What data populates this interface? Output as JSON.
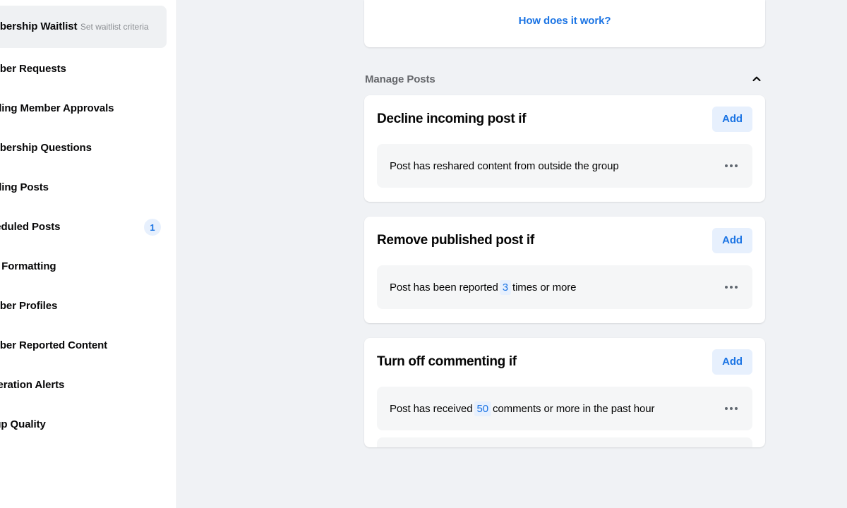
{
  "sidebar": {
    "items": [
      {
        "label": "Membership Waitlist",
        "sublabel": "Set waitlist criteria",
        "badge": "",
        "icon": "list-icon",
        "active": true
      },
      {
        "label": "Member Requests",
        "sublabel": "",
        "badge": "",
        "icon": "person-add-icon",
        "active": false
      },
      {
        "label": "Pending Member Approvals",
        "sublabel": "",
        "badge": "",
        "icon": "clock-icon",
        "active": false
      },
      {
        "label": "Membership Questions",
        "sublabel": "",
        "badge": "",
        "icon": "question-icon",
        "active": false
      },
      {
        "label": "Pending Posts",
        "sublabel": "",
        "badge": "",
        "icon": "posts-icon",
        "active": false
      },
      {
        "label": "Scheduled Posts",
        "sublabel": "",
        "badge": "1",
        "icon": "calendar-icon",
        "active": false
      },
      {
        "label": "Post Formatting",
        "sublabel": "",
        "badge": "",
        "icon": "format-icon",
        "active": false
      },
      {
        "label": "Member Profiles",
        "sublabel": "",
        "badge": "",
        "icon": "profile-icon",
        "active": false
      },
      {
        "label": "Member Reported Content",
        "sublabel": "",
        "badge": "",
        "icon": "flag-icon",
        "active": false
      },
      {
        "label": "Moderation Alerts",
        "sublabel": "",
        "badge": "",
        "icon": "bell-icon",
        "active": false
      },
      {
        "label": "Group Quality",
        "sublabel": "",
        "badge": "",
        "icon": "shield-icon",
        "active": false
      }
    ]
  },
  "main": {
    "top_card": {
      "link_label": "How does it work?"
    },
    "section": {
      "title": "Manage Posts",
      "collapse_icon": "chevron-up-icon",
      "expanded": true
    },
    "rules": [
      {
        "title": "Decline incoming post if",
        "add_label": "Add",
        "conditions": [
          {
            "prefix": "Post has reshared content from outside the group",
            "token": "",
            "suffix": "",
            "menu_icon": "ellipsis-icon"
          }
        ]
      },
      {
        "title": "Remove published post if",
        "add_label": "Add",
        "conditions": [
          {
            "prefix": "Post has been reported",
            "token": "3",
            "suffix": "times or more",
            "menu_icon": "ellipsis-icon"
          }
        ]
      },
      {
        "title": "Turn off commenting if",
        "add_label": "Add",
        "conditions": [
          {
            "prefix": "Post has received",
            "token": "50",
            "suffix": "comments or more in the past hour",
            "menu_icon": "ellipsis-icon"
          }
        ]
      }
    ]
  },
  "colors": {
    "page_background": "#f0f2f5",
    "card_background": "#ffffff",
    "accent_blue": "#1b74e4",
    "accent_blue_soft": "#e7f0fd",
    "condition_background": "#f5f6f7",
    "secondary_text": "#65676b",
    "primary_text": "#050505"
  }
}
